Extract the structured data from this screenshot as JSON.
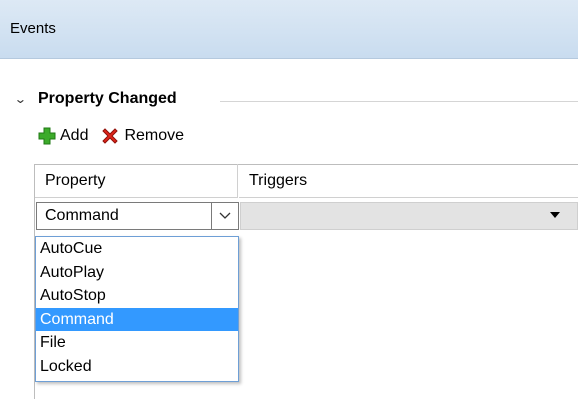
{
  "header": {
    "title": "Events"
  },
  "group": {
    "title": "Property Changed"
  },
  "toolbar": {
    "add_label": "Add",
    "remove_label": "Remove"
  },
  "grid": {
    "columns": [
      "Property",
      "Triggers"
    ],
    "row": {
      "property_value": "Command",
      "triggers_value": ""
    }
  },
  "dropdown": {
    "options": [
      "AutoCue",
      "AutoPlay",
      "AutoStop",
      "Command",
      "File",
      "Locked"
    ],
    "selected": "Command"
  },
  "colors": {
    "header_bg": "#dde9f5",
    "selection": "#3399ff",
    "dropdown_border": "#6e9fd6"
  },
  "icons": {
    "add": "green-plus-icon",
    "remove": "red-x-icon",
    "collapse": "chevron-down-icon",
    "combo": "chevron-down-icon",
    "triggers": "dropdown-arrow-icon"
  }
}
